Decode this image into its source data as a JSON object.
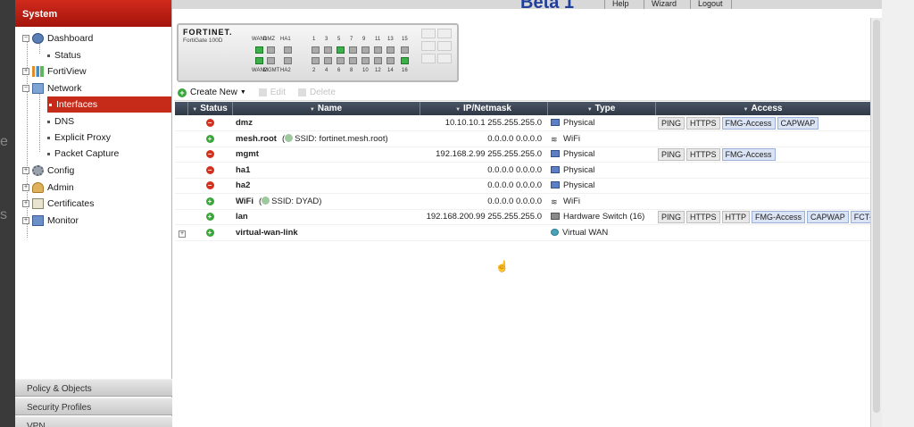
{
  "brand": {
    "text": "Beta 1"
  },
  "top_links": [
    "Help",
    "Wizard",
    "Logout"
  ],
  "sidebar": {
    "header": "System",
    "items": [
      {
        "label": "Dashboard",
        "type": "folder",
        "expanded": true,
        "icon": "dashboard-icon"
      },
      {
        "label": "Status",
        "type": "leaf"
      },
      {
        "label": "FortiView",
        "type": "folder",
        "expanded": false,
        "icon": "fortiview-icon"
      },
      {
        "label": "Network",
        "type": "folder",
        "expanded": true,
        "icon": "network-icon"
      },
      {
        "label": "Interfaces",
        "type": "leaf",
        "selected": true
      },
      {
        "label": "DNS",
        "type": "leaf"
      },
      {
        "label": "Explicit Proxy",
        "type": "leaf"
      },
      {
        "label": "Packet Capture",
        "type": "leaf"
      },
      {
        "label": "Config",
        "type": "folder",
        "expanded": false,
        "icon": "config-icon"
      },
      {
        "label": "Admin",
        "type": "folder",
        "expanded": false,
        "icon": "admin-icon"
      },
      {
        "label": "Certificates",
        "type": "folder",
        "expanded": false,
        "icon": "certificates-icon"
      },
      {
        "label": "Monitor",
        "type": "folder",
        "expanded": false,
        "icon": "monitor-icon"
      }
    ],
    "bottom_nav": [
      "Policy & Objects",
      "Security Profiles",
      "VPN"
    ]
  },
  "device": {
    "logo": "FORTINET.",
    "model": "FortiGate 100D",
    "labels_top": [
      "WAN1",
      "DMZ",
      "HA1",
      "1",
      "3",
      "5",
      "7",
      "9",
      "11",
      "13",
      "15"
    ],
    "labels_bottom": [
      "WAN2",
      "MGMT",
      "HA2",
      "2",
      "4",
      "6",
      "8",
      "10",
      "12",
      "14",
      "16"
    ],
    "ports_up_top": [
      "WAN1",
      "5"
    ],
    "ports_up_bottom": [
      "WAN2",
      "16"
    ]
  },
  "toolbar": {
    "create_new": "Create New",
    "edit": "Edit",
    "delete": "Delete"
  },
  "table": {
    "columns": [
      "Status",
      "Name",
      "IP/Netmask",
      "Type",
      "Access"
    ],
    "rows": [
      {
        "status": "down",
        "name": "dmz",
        "ssid": "",
        "ip": "10.10.10.1 255.255.255.0",
        "type": "Physical",
        "type_icon": "ethernet-port-icon",
        "access": [
          "PING",
          "HTTPS",
          "FMG-Access",
          "CAPWAP"
        ]
      },
      {
        "status": "up",
        "name": "mesh.root",
        "ssid": "SSID: fortinet.mesh.root",
        "ip": "0.0.0.0 0.0.0.0",
        "type": "WiFi",
        "type_icon": "wifi-icon",
        "access": []
      },
      {
        "status": "down",
        "name": "mgmt",
        "ssid": "",
        "ip": "192.168.2.99 255.255.255.0",
        "type": "Physical",
        "type_icon": "ethernet-port-icon",
        "access": [
          "PING",
          "HTTPS",
          "FMG-Access"
        ]
      },
      {
        "status": "down",
        "name": "ha1",
        "ssid": "",
        "ip": "0.0.0.0 0.0.0.0",
        "type": "Physical",
        "type_icon": "ethernet-port-icon",
        "access": []
      },
      {
        "status": "down",
        "name": "ha2",
        "ssid": "",
        "ip": "0.0.0.0 0.0.0.0",
        "type": "Physical",
        "type_icon": "ethernet-port-icon",
        "access": []
      },
      {
        "status": "up",
        "name": "WiFi",
        "ssid": "SSID: DYAD",
        "ip": "0.0.0.0 0.0.0.0",
        "type": "WiFi",
        "type_icon": "wifi-icon",
        "access": []
      },
      {
        "status": "up",
        "name": "lan",
        "ssid": "",
        "ip": "192.168.200.99 255.255.255.0",
        "type": "Hardware Switch (16)",
        "type_icon": "hardware-switch-icon",
        "access": [
          "PING",
          "HTTPS",
          "HTTP",
          "FMG-Access",
          "CAPWAP",
          "FCT-Access"
        ]
      },
      {
        "status": "up",
        "name": "virtual-wan-link",
        "ssid": "",
        "ip": "",
        "type": "Virtual WAN",
        "type_icon": "virtual-wan-icon",
        "access": [],
        "expandable": true
      }
    ]
  }
}
